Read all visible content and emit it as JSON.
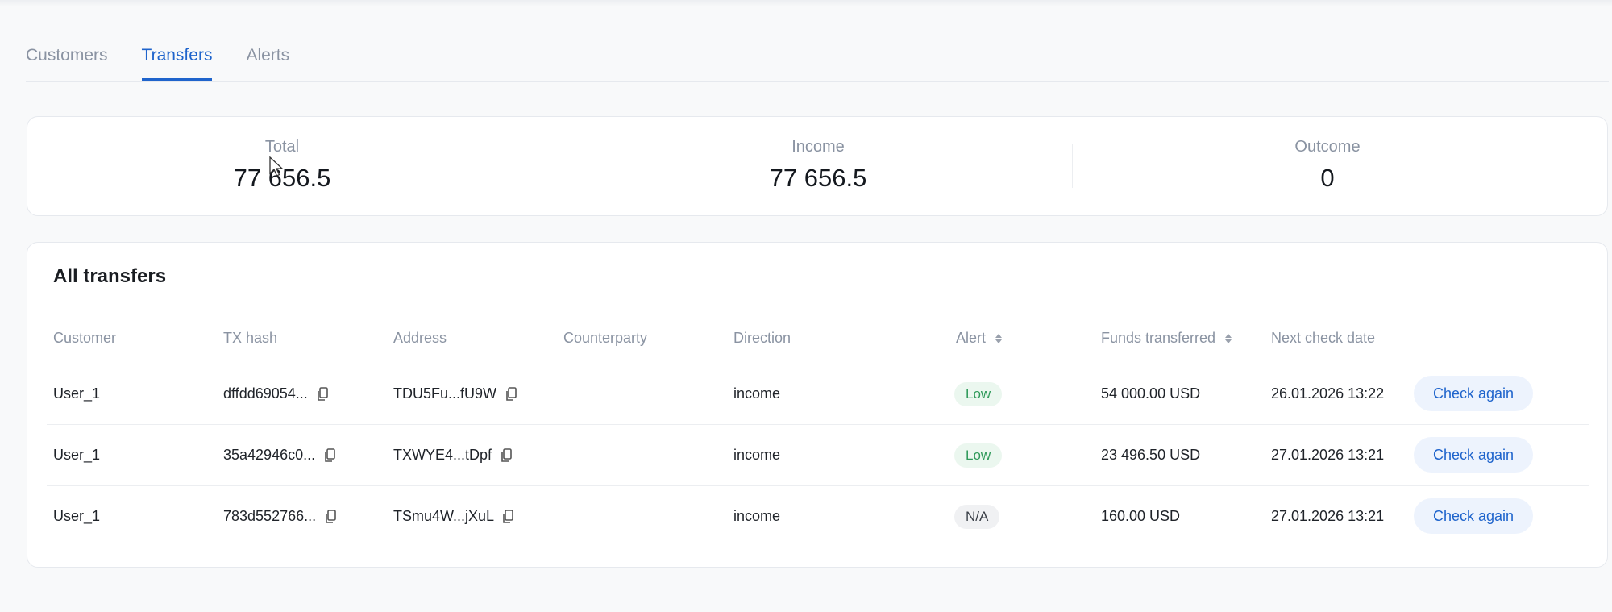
{
  "tabs": [
    {
      "label": "Customers"
    },
    {
      "label": "Transfers"
    },
    {
      "label": "Alerts"
    }
  ],
  "summary": {
    "total": {
      "label": "Total",
      "value": "77 656.5"
    },
    "income": {
      "label": "Income",
      "value": "77 656.5"
    },
    "outcome": {
      "label": "Outcome",
      "value": "0"
    }
  },
  "table": {
    "title": "All transfers",
    "columns": [
      "Customer",
      "TX hash",
      "Address",
      "Counterparty",
      "Direction",
      "Alert",
      "Funds transferred",
      "Next check date"
    ],
    "rows": [
      {
        "customer": "User_1",
        "tx_hash": "dffdd69054...",
        "address": "TDU5Fu...fU9W",
        "counterparty": "",
        "direction": "income",
        "alert": "Low",
        "funds": "54 000.00 USD",
        "next_check": "26.01.2026 13:22",
        "action": "Check again"
      },
      {
        "customer": "User_1",
        "tx_hash": "35a42946c0...",
        "address": "TXWYE4...tDpf",
        "counterparty": "",
        "direction": "income",
        "alert": "Low",
        "funds": "23 496.50 USD",
        "next_check": "27.01.2026 13:21",
        "action": "Check again"
      },
      {
        "customer": "User_1",
        "tx_hash": "783d552766...",
        "address": "TSmu4W...jXuL",
        "counterparty": "",
        "direction": "income",
        "alert": "N/A",
        "funds": "160.00 USD",
        "next_check": "27.01.2026 13:21",
        "action": "Check again"
      }
    ]
  },
  "icons": {
    "copy": "copy-icon",
    "sort": "sort-icon",
    "cursor": "mouse-pointer-icon"
  },
  "colors": {
    "accent": "#1f64cc",
    "low_badge_bg": "#ebf7ef",
    "low_badge_text": "#2f9a5a",
    "na_badge_bg": "#f0f1f3"
  }
}
